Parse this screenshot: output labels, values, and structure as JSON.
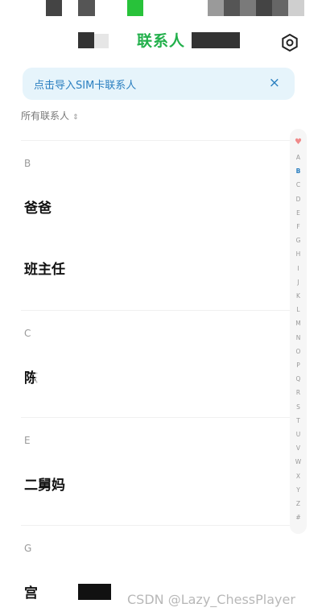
{
  "header": {
    "title": "联系人"
  },
  "banner": {
    "text": "点击导入SIM卡联系人",
    "close": "×"
  },
  "filter": {
    "label": "所有联系人",
    "caret": "⌃⌄"
  },
  "sections": [
    {
      "letter": "B",
      "contacts": [
        "爸爸",
        "班主任"
      ]
    },
    {
      "letter": "C",
      "contacts": [
        "陈"
      ]
    },
    {
      "letter": "E",
      "contacts": [
        "二舅妈"
      ]
    },
    {
      "letter": "G",
      "contacts": [
        "宫"
      ]
    }
  ],
  "index": {
    "heart": "♥",
    "letters": [
      "A",
      "B",
      "C",
      "D",
      "E",
      "F",
      "G",
      "H",
      "I",
      "J",
      "K",
      "L",
      "M",
      "N",
      "O",
      "P",
      "Q",
      "R",
      "S",
      "T",
      "U",
      "V",
      "W",
      "X",
      "Y",
      "Z",
      "#"
    ],
    "active": "B"
  },
  "watermark": "CSDN @Lazy_ChessPlayer",
  "colors": {
    "accent": "#22b04b",
    "banner_bg": "#e6f4fb",
    "banner_text": "#2a7fc0"
  }
}
